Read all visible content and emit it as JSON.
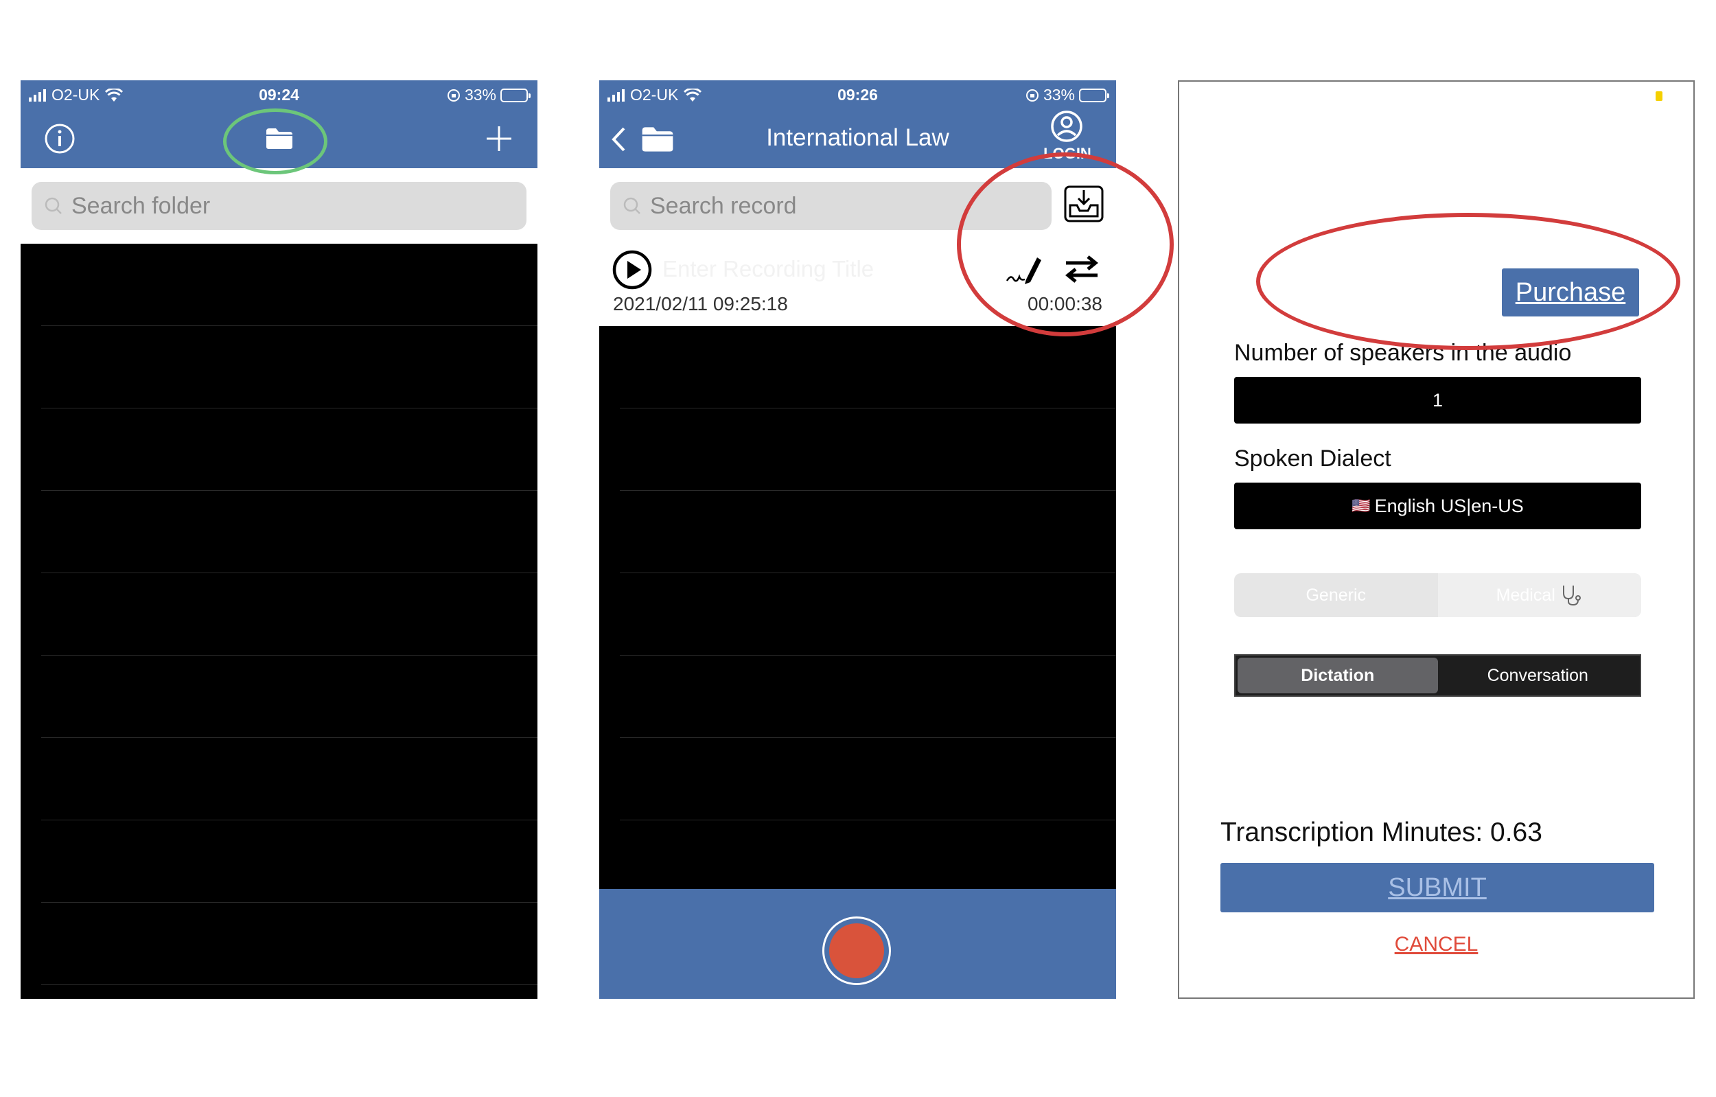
{
  "status": {
    "carrier": "O2-UK",
    "battery_percent": "33%",
    "battery_level": 0.33,
    "panel1_time": "09:24",
    "panel2_time": "09:26"
  },
  "panel1": {
    "search_placeholder": "Search folder"
  },
  "panel2": {
    "title": "International Law",
    "login_label": "LOGIN",
    "search_placeholder": "Search record",
    "record": {
      "title_placeholder": "Enter Recording Title",
      "timestamp": "2021/02/11 09:25:18",
      "duration": "00:00:38"
    }
  },
  "panel3": {
    "purchase_label": "Purchase",
    "speakers_label": "Number of speakers in the audio",
    "speakers_value": "1",
    "dialect_label": "Spoken Dialect",
    "dialect_flag": "🇺🇸",
    "dialect_value": "English US|en-US",
    "domain_options": [
      "Generic",
      "Medical"
    ],
    "mode_options": [
      "Dictation",
      "Conversation"
    ],
    "mode_selected": "Dictation",
    "minutes_text": "Transcription Minutes: 0.63",
    "submit_label": "SUBMIT",
    "cancel_label": "CANCEL"
  },
  "colors": {
    "brand_blue": "#4a70aa",
    "record_red": "#d9533b",
    "annotation_red": "#d23c3c",
    "annotation_green": "#6cc67a",
    "cancel_red": "#e04a3a"
  }
}
